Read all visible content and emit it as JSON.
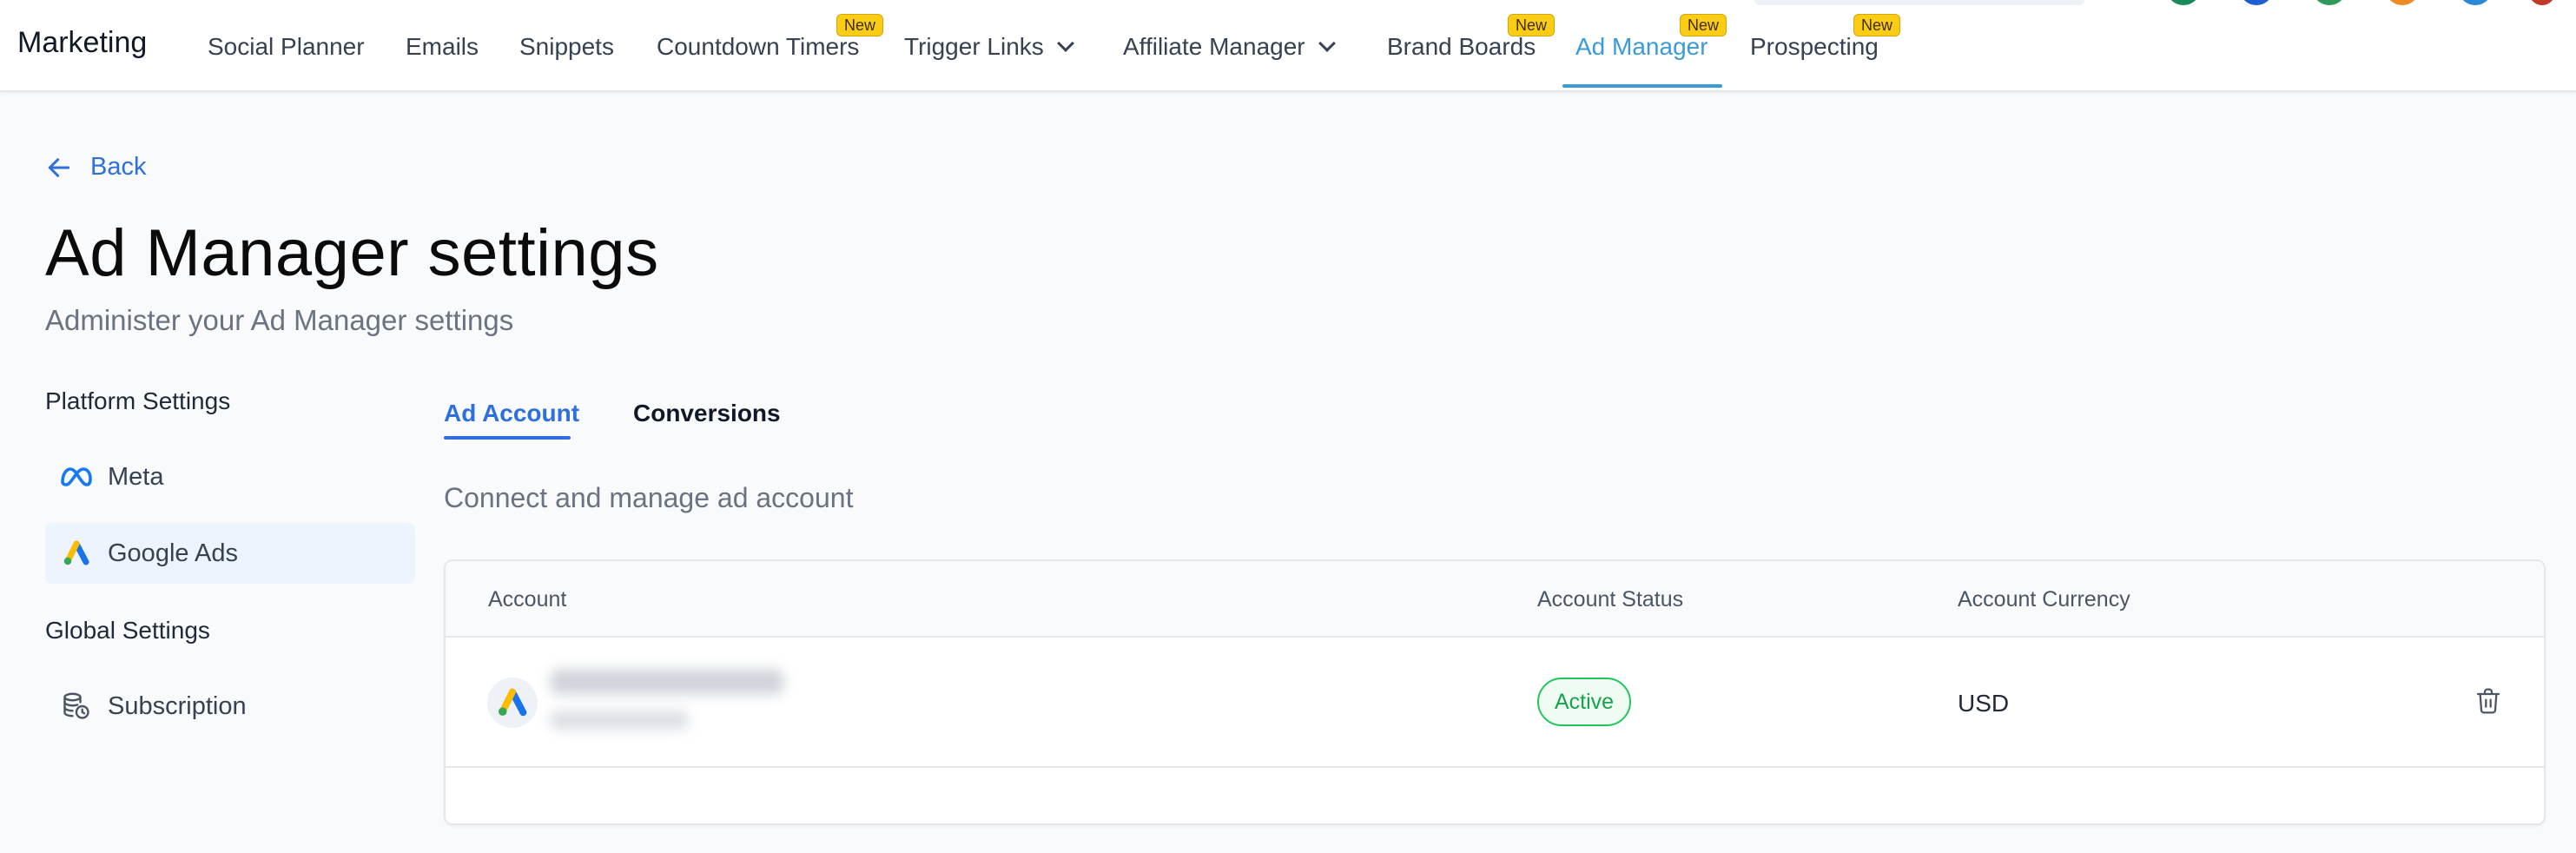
{
  "app": {
    "title": "Marketing"
  },
  "nav": {
    "items": [
      {
        "label": "Social Planner",
        "badge": ""
      },
      {
        "label": "Emails",
        "badge": ""
      },
      {
        "label": "Snippets",
        "badge": ""
      },
      {
        "label": "Countdown Timers",
        "badge": "New"
      },
      {
        "label": "Trigger Links",
        "badge": ""
      },
      {
        "label": "Affiliate Manager",
        "badge": ""
      },
      {
        "label": "Brand Boards",
        "badge": "New"
      },
      {
        "label": "Ad Manager",
        "badge": "New"
      },
      {
        "label": "Prospecting",
        "badge": "New"
      }
    ],
    "active": "Ad Manager"
  },
  "page": {
    "back_label": "Back",
    "title": "Ad Manager settings",
    "subtitle": "Administer your Ad Manager settings"
  },
  "sidebar": {
    "platform_heading": "Platform Settings",
    "platform_items": [
      {
        "label": "Meta",
        "icon": "meta-icon"
      },
      {
        "label": "Google Ads",
        "icon": "google-ads-icon"
      }
    ],
    "global_heading": "Global Settings",
    "global_items": [
      {
        "label": "Subscription",
        "icon": "database-clock-icon"
      }
    ],
    "selected": "Google Ads"
  },
  "tabs": [
    {
      "label": "Ad Account"
    },
    {
      "label": "Conversions"
    }
  ],
  "section": {
    "description": "Connect and manage ad account"
  },
  "table": {
    "columns": [
      "Account",
      "Account Status",
      "Account Currency"
    ],
    "rows": [
      {
        "status": "Active",
        "currency": "USD"
      }
    ]
  },
  "colors": {
    "accent": "#2f6fdc",
    "nav_active": "#3b9bd6",
    "badge": "#facc15",
    "status_active": "#16a34a"
  }
}
